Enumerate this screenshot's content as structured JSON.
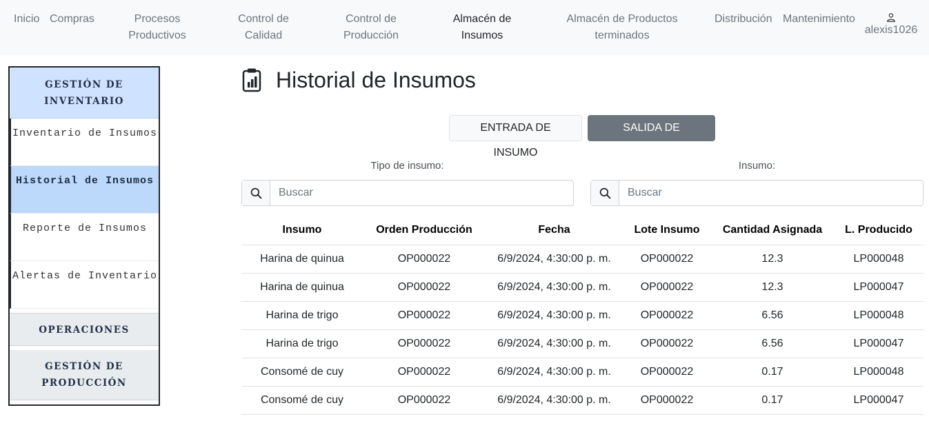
{
  "nav": {
    "items": [
      {
        "label": "Inicio"
      },
      {
        "label": "Compras"
      },
      {
        "label": "Procesos Productivos"
      },
      {
        "label": "Control de Calidad"
      },
      {
        "label": "Control de Producción"
      },
      {
        "label": "Almacén de Insumos"
      },
      {
        "label": "Almacén de Productos terminados"
      },
      {
        "label": "Distribución"
      },
      {
        "label": "Mantenimiento"
      }
    ],
    "user": {
      "icon": "user-icon",
      "name": "alexis1026"
    }
  },
  "sidebar": {
    "section_inventory": "GESTIÓN DE INVENTARIO",
    "items": [
      {
        "label": "Inventario de Insumos"
      },
      {
        "label": "Historial de Insumos"
      },
      {
        "label": "Reporte de Insumos"
      },
      {
        "label": "Alertas de Inventario"
      }
    ],
    "section_operations": "OPERACIONES",
    "section_production": "GESTIÓN DE PRODUCCIÓN"
  },
  "main": {
    "title_icon": "clipboard-chart-icon",
    "title": "Historial de Insumos",
    "buttons": {
      "entrada": "ENTRADA DE INSUMO",
      "salida": "SALIDA DE INSUMOS"
    },
    "filters": {
      "tipo_label": "Tipo de insumo:",
      "tipo_placeholder": "Buscar",
      "insumo_label": "Insumo:",
      "insumo_placeholder": "Buscar"
    },
    "table": {
      "headers": [
        "Insumo",
        "Orden Producción",
        "Fecha",
        "Lote Insumo",
        "Cantidad Asignada",
        "L. Producido"
      ],
      "rows": [
        [
          "Harina de quinua",
          "OP000022",
          "6/9/2024, 4:30:00 p. m.",
          "OP000022",
          "12.3",
          "LP000048"
        ],
        [
          "Harina de quinua",
          "OP000022",
          "6/9/2024, 4:30:00 p. m.",
          "OP000022",
          "12.3",
          "LP000047"
        ],
        [
          "Harina de trigo",
          "OP000022",
          "6/9/2024, 4:30:00 p. m.",
          "OP000022",
          "6.56",
          "LP000048"
        ],
        [
          "Harina de trigo",
          "OP000022",
          "6/9/2024, 4:30:00 p. m.",
          "OP000022",
          "6.56",
          "LP000047"
        ],
        [
          "Consomé de cuy",
          "OP000022",
          "6/9/2024, 4:30:00 p. m.",
          "OP000022",
          "0.17",
          "LP000048"
        ],
        [
          "Consomé de cuy",
          "OP000022",
          "6/9/2024, 4:30:00 p. m.",
          "OP000022",
          "0.17",
          "LP000047"
        ]
      ]
    }
  },
  "colors": {
    "nav_bg": "#f8f9fa",
    "sidebar_active": "#cfe2ff",
    "sidebar_section": "#e9ecef",
    "secondary_button": "#6c757d"
  }
}
